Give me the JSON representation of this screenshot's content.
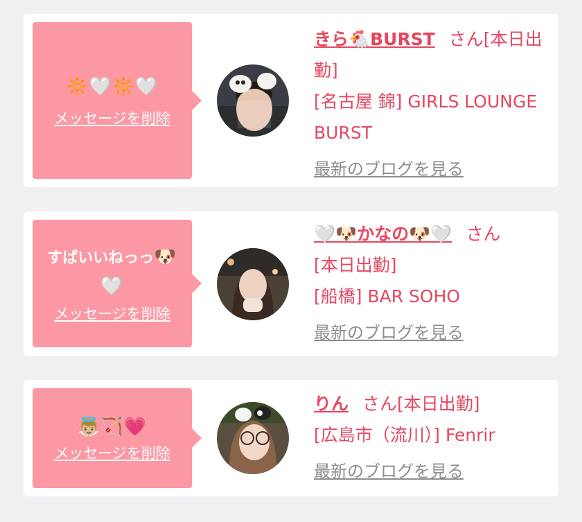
{
  "posts": [
    {
      "message": "",
      "message_emoji": "🔆🤍🔆🤍",
      "delete_label": "メッセージを削除",
      "name": "きら🐔BURST",
      "san": "さん",
      "status": "[本日出勤]",
      "shop": "[名古屋 錦] GIRLS LOUNGE BURST",
      "blog_link": "最新のブログを見る",
      "avatar": "girl-with-bow-photo"
    },
    {
      "message": "すぱいいねっっ",
      "message_emoji": "🐶🤍",
      "delete_label": "メッセージを削除",
      "name": "🤍🐶かなの🐶🤍",
      "san": "さん",
      "status": "[本日出勤]",
      "shop": "[船橋] BAR SOHO",
      "blog_link": "最新のブログを見る",
      "avatar": "girl-night-photo"
    },
    {
      "message": "",
      "message_emoji": "👼🏼🏹💗",
      "delete_label": "メッセージを削除",
      "name": "りん",
      "san": "さん",
      "status": "[本日出勤]",
      "shop": "[広島市（流川）] Fenrir",
      "blog_link": "最新のブログを見る",
      "avatar": "girl-glasses-photo"
    }
  ],
  "colors": {
    "bubble": "#fc98a4",
    "accent": "#e6465f",
    "link_gray": "#8d8d8d",
    "background": "#f0f0f2"
  }
}
